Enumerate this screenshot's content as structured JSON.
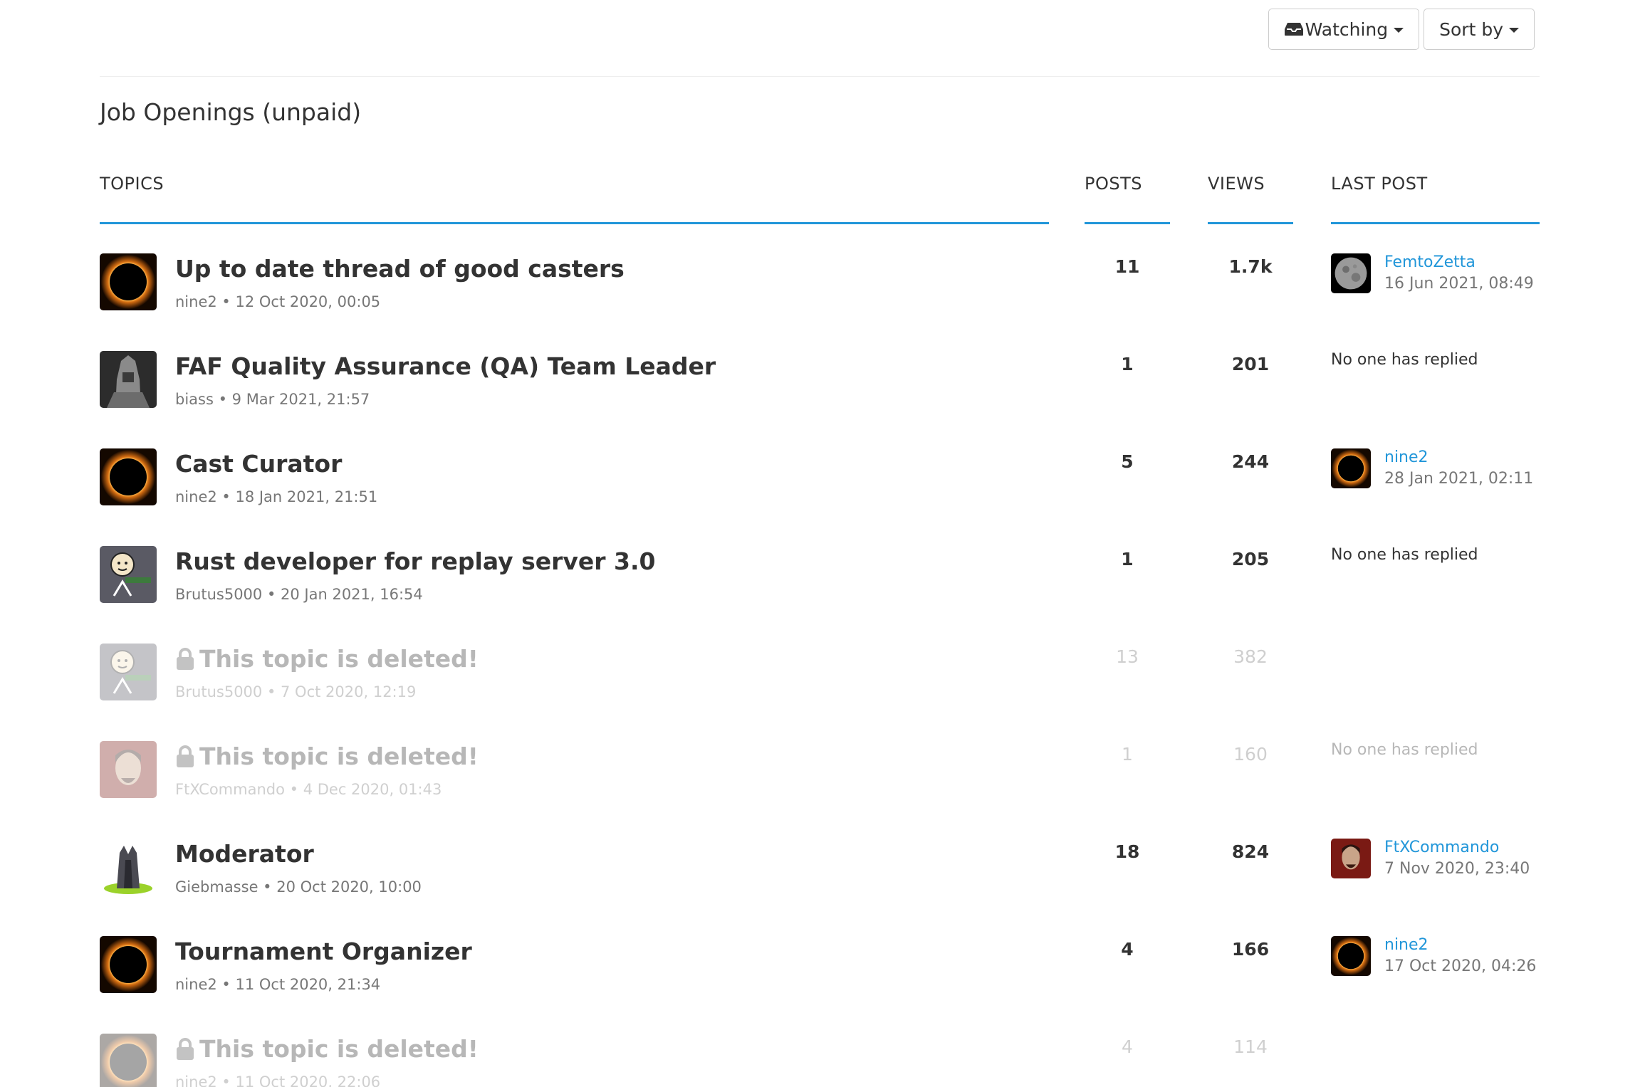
{
  "toolbar": {
    "watching_label": "Watching",
    "sort_label": "Sort by"
  },
  "category": {
    "title": "Job Openings (unpaid)"
  },
  "headers": {
    "topics": "TOPICS",
    "posts": "POSTS",
    "views": "VIEWS",
    "last_post": "LAST POST"
  },
  "colors": {
    "accent": "#2196d9",
    "text": "#333333",
    "muted": "#777777"
  },
  "topics": [
    {
      "title": "Up to date thread of good casters",
      "author": "nine2",
      "date": "12 Oct 2020, 00:05",
      "meta": "nine2 • 12 Oct 2020, 00:05",
      "posts": "11",
      "views": "1.7k",
      "avatar": "eclipse",
      "last_user": "FemtoZetta",
      "last_date": "16 Jun 2021, 08:49",
      "last_avatar": "moon",
      "deleted": false
    },
    {
      "title": "FAF Quality Assurance (QA) Team Leader",
      "author": "biass",
      "date": "9 Mar 2021, 21:57",
      "meta": "biass • 9 Mar 2021, 21:57",
      "posts": "1",
      "views": "201",
      "avatar": "knight",
      "no_reply": "No one has replied",
      "deleted": false
    },
    {
      "title": "Cast Curator",
      "author": "nine2",
      "date": "18 Jan 2021, 21:51",
      "meta": "nine2 • 18 Jan 2021, 21:51",
      "posts": "5",
      "views": "244",
      "avatar": "eclipse",
      "last_user": "nine2",
      "last_date": "28 Jan 2021, 02:11",
      "last_avatar": "eclipse",
      "deleted": false
    },
    {
      "title": "Rust developer for replay server 3.0",
      "author": "Brutus5000",
      "date": "20 Jan 2021, 16:54",
      "meta": "Brutus5000 • 20 Jan 2021, 16:54",
      "posts": "1",
      "views": "205",
      "avatar": "cartoon",
      "no_reply": "No one has replied",
      "deleted": false
    },
    {
      "title": "This topic is deleted!",
      "author": "Brutus5000",
      "date": "7 Oct 2020, 12:19",
      "meta": "Brutus5000 • 7 Oct 2020, 12:19",
      "posts": "13",
      "views": "382",
      "avatar": "cartoon",
      "deleted": true
    },
    {
      "title": "This topic is deleted!",
      "author": "FtXCommando",
      "date": "4 Dec 2020, 01:43",
      "meta": "FtXCommando • 4 Dec 2020, 01:43",
      "posts": "1",
      "views": "160",
      "avatar": "portrait",
      "no_reply": "No one has replied",
      "deleted": true
    },
    {
      "title": "Moderator",
      "author": "Giebmasse",
      "date": "20 Oct 2020, 10:00",
      "meta": "Giebmasse • 20 Oct 2020, 10:00",
      "posts": "18",
      "views": "824",
      "avatar": "tower",
      "last_user": "FtXCommando",
      "last_date": "7 Nov 2020, 23:40",
      "last_avatar": "portrait",
      "deleted": false
    },
    {
      "title": "Tournament Organizer",
      "author": "nine2",
      "date": "11 Oct 2020, 21:34",
      "meta": "nine2 • 11 Oct 2020, 21:34",
      "posts": "4",
      "views": "166",
      "avatar": "eclipse",
      "last_user": "nine2",
      "last_date": "17 Oct 2020, 04:26",
      "last_avatar": "eclipse",
      "deleted": false
    },
    {
      "title": "This topic is deleted!",
      "author": "nine2",
      "date": "11 Oct 2020, 22:06",
      "meta": "nine2 • 11 Oct 2020, 22:06",
      "posts": "4",
      "views": "114",
      "avatar": "eclipse",
      "deleted": true
    }
  ]
}
